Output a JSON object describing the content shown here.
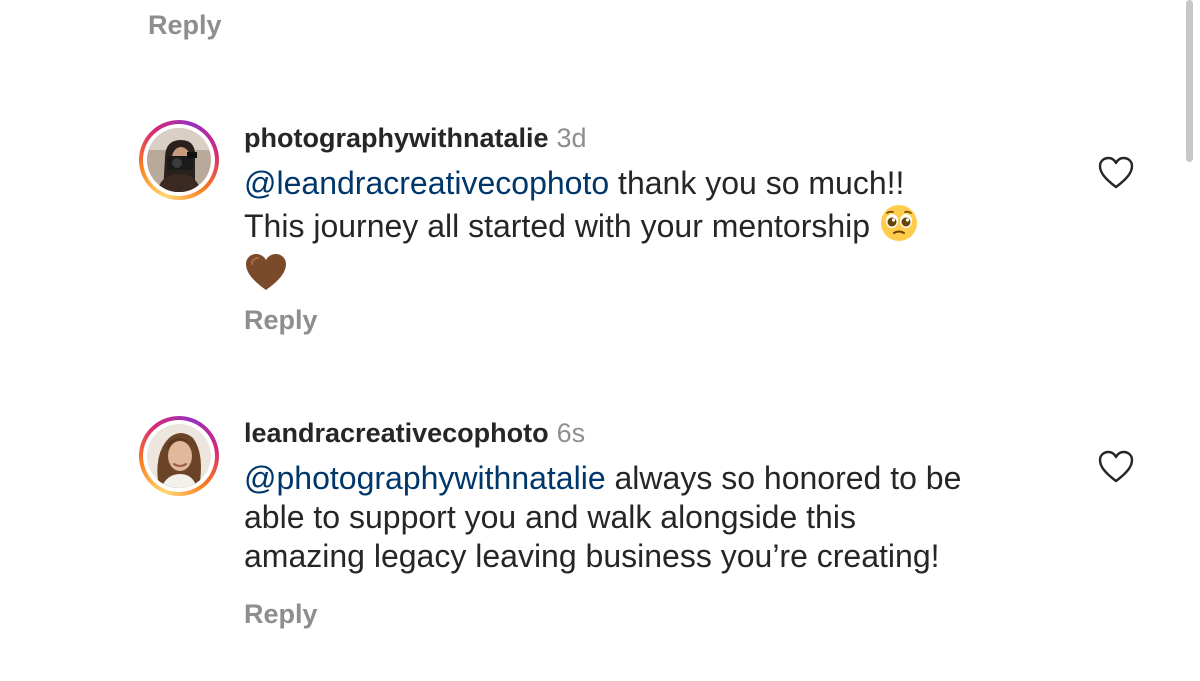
{
  "thread": {
    "top_reply_label": "Reply",
    "comments": [
      {
        "username": "photographywithnatalie",
        "time": "3d",
        "mention": "@leandracreativecophoto",
        "text_line1": " thank you so much!!",
        "text_line2": "This journey all started with your mentorship",
        "emoji_1": "pleading-face-emoji",
        "emoji_2": "brown-heart-emoji",
        "reply_label": "Reply",
        "like_icon": "heart-outline-icon"
      },
      {
        "username": "leandracreativecophoto",
        "time": "6s",
        "mention": "@photographywithnatalie",
        "text_line1": " always so honored to be",
        "text_line2": "able to support you and walk alongside this",
        "text_line3": "amazing legacy leaving business you’re creating!",
        "reply_label": "Reply",
        "like_icon": "heart-outline-icon"
      }
    ]
  },
  "colors": {
    "mention": "#00376b",
    "secondary_text": "#8e8e8e",
    "primary_text": "#262626",
    "brown_heart": "#7b4a2a"
  }
}
